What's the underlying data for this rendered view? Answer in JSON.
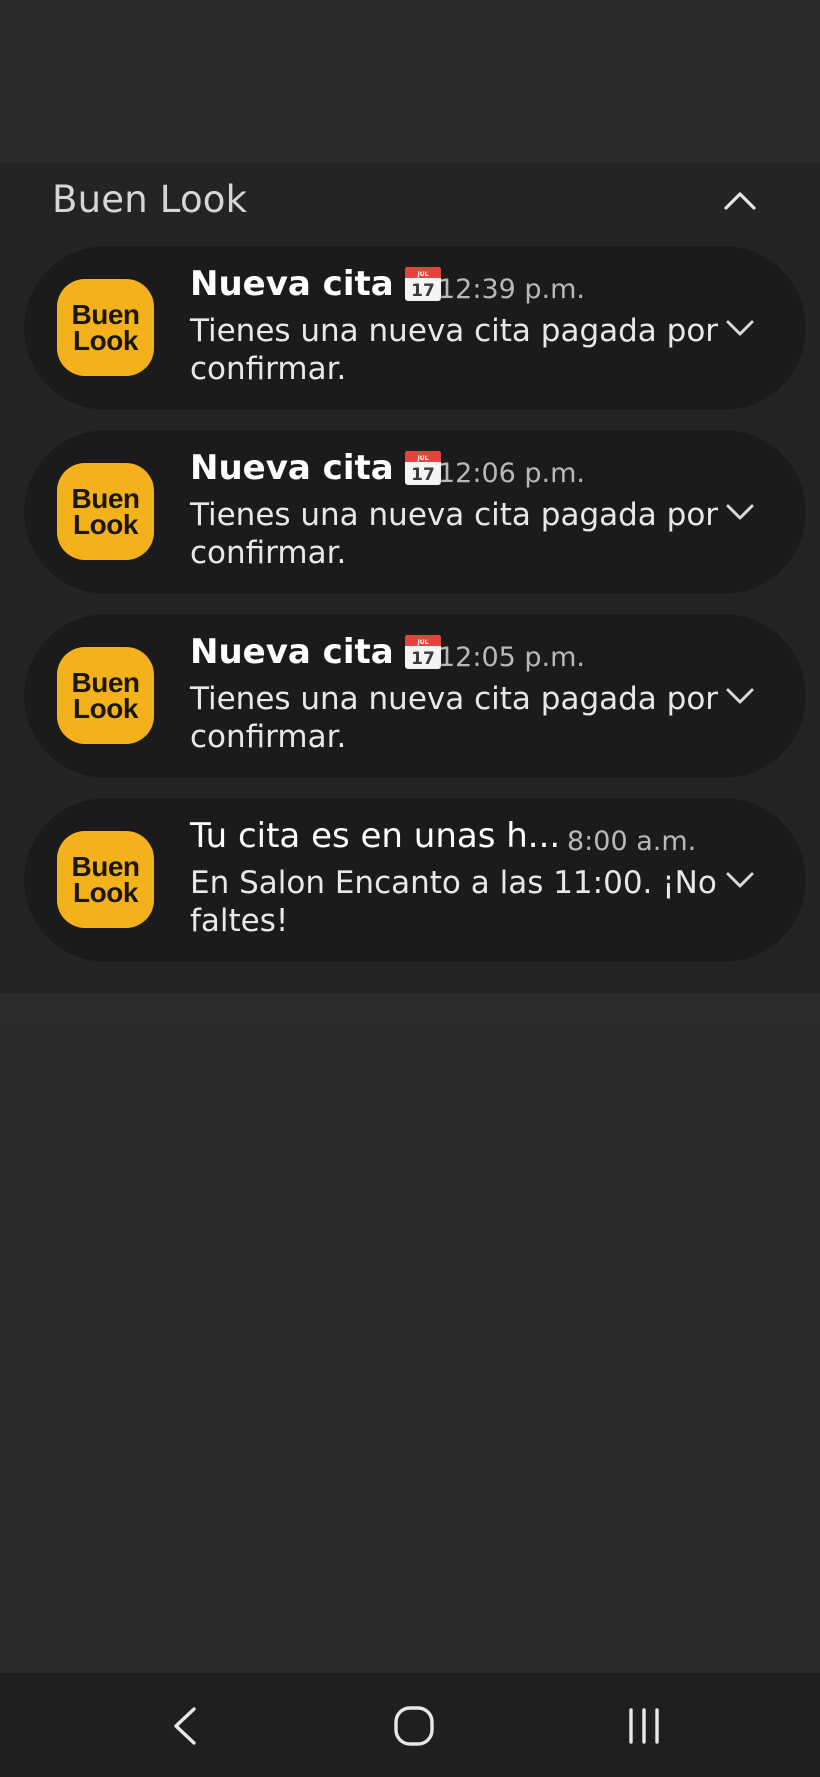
{
  "group": {
    "title": "Buen Look"
  },
  "app_icon": {
    "line1": "Buen",
    "line2": "Look",
    "color": "#f3b21c"
  },
  "calendar_icon": {
    "month": "JUL",
    "day": "17"
  },
  "notifications": [
    {
      "title": "Nueva cita",
      "time": "12:39 p.m.",
      "body": "Tienes una nueva cita pagada por confirmar."
    },
    {
      "title": "Nueva cita",
      "time": "12:06 p.m.",
      "body": "Tienes una nueva cita pagada por confirmar."
    },
    {
      "title": "Nueva cita",
      "time": "12:05 p.m.",
      "body": "Tienes una nueva cita pagada por confirmar."
    },
    {
      "title": "Tu cita es en unas h...",
      "time": "8:00 a.m.",
      "body": "En Salon Encanto a las 11:00. ¡No faltes!"
    }
  ]
}
